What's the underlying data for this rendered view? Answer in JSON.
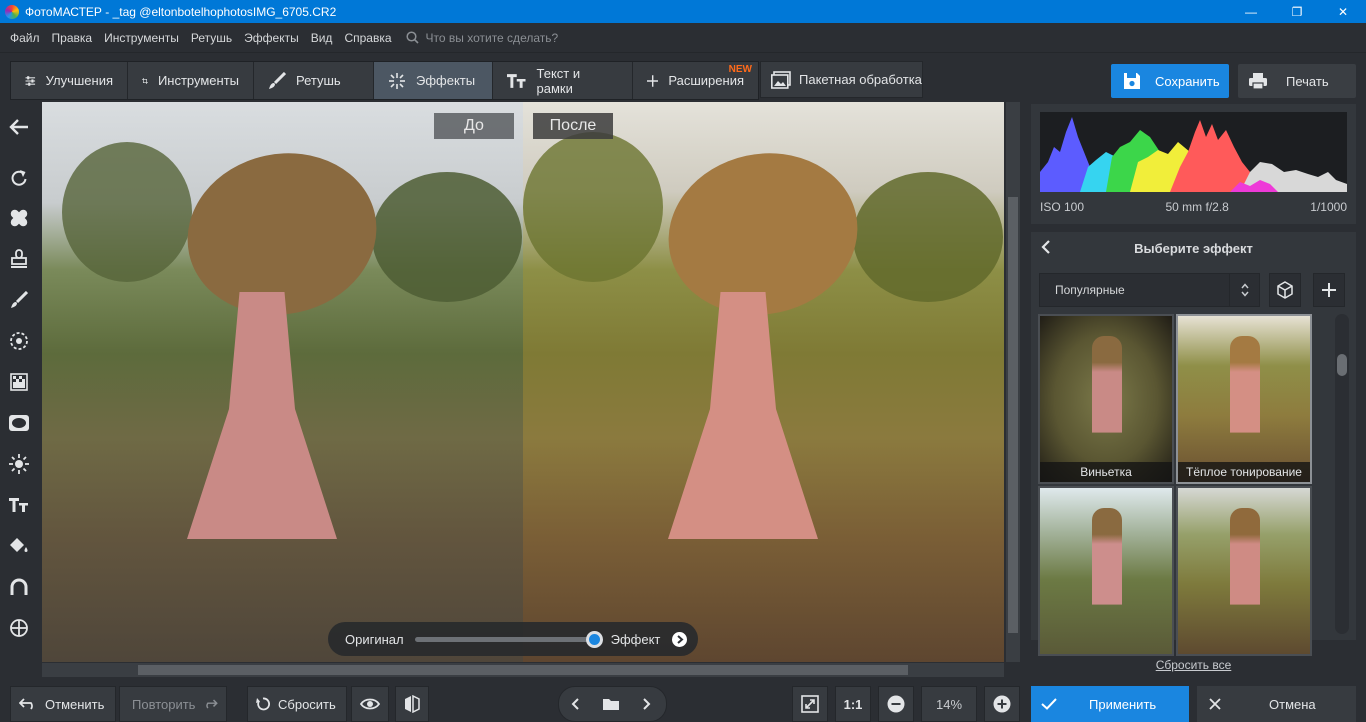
{
  "titlebar": {
    "title": "ФотоМАСТЕР - _tag @eltonbotelhophotosIMG_6705.CR2",
    "min": "—",
    "max": "❐",
    "close": "✕"
  },
  "menu": {
    "items": [
      "Файл",
      "Правка",
      "Инструменты",
      "Ретушь",
      "Эффекты",
      "Вид",
      "Справка"
    ],
    "search_placeholder": "Что вы хотите сделать?"
  },
  "tabs": [
    {
      "label": "Улучшения",
      "icon": "sliders-icon"
    },
    {
      "label": "Инструменты",
      "icon": "crop-icon"
    },
    {
      "label": "Ретушь",
      "icon": "brush-icon"
    },
    {
      "label": "Эффекты",
      "icon": "sparkle-icon",
      "active": true
    },
    {
      "label": "Текст и рамки",
      "icon": "text-icon"
    },
    {
      "label": "Расширения",
      "icon": "plus-icon",
      "badge": "NEW"
    }
  ],
  "batch_label": "Пакетная обработка",
  "save_label": "Сохранить",
  "print_label": "Печать",
  "preview": {
    "before_label": "До",
    "after_label": "После",
    "slider_original": "Оригинал",
    "slider_effect": "Эффект",
    "slider_value": 1.0
  },
  "histogram": {
    "iso": "ISO 100",
    "lens": "50 mm f/2.8",
    "shutter": "1/1000"
  },
  "effects_panel": {
    "header": "Выберите эффект",
    "category": "Популярные",
    "reset_all": "Сбросить все",
    "thumbnails": [
      {
        "caption": "Виньетка"
      },
      {
        "caption": "Тёплое тонирование"
      },
      {
        "caption": ""
      },
      {
        "caption": ""
      }
    ]
  },
  "bottom": {
    "undo": "Отменить",
    "redo": "Повторить",
    "reset": "Сбросить",
    "zoom_ratio": "1:1",
    "zoom_percent": "14%",
    "apply": "Применить",
    "cancel": "Отмена"
  },
  "colors": {
    "accent": "#1a86e0",
    "titlebar": "#0078d7",
    "new_badge": "#ff6a1a"
  }
}
